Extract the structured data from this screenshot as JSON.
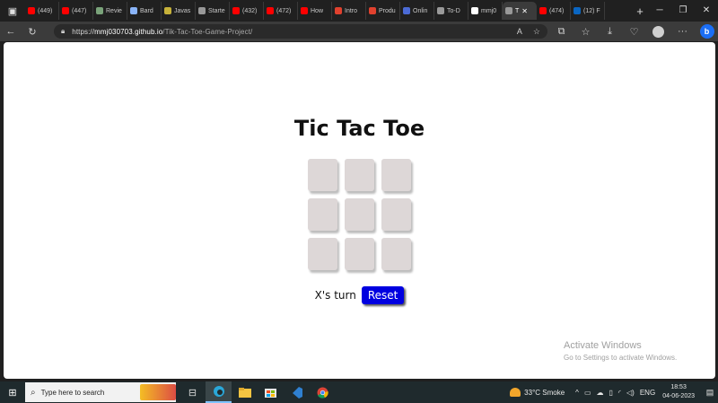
{
  "tabs": [
    {
      "label": "(449)",
      "icon": "youtube-icon",
      "color": "#ff0000"
    },
    {
      "label": "(447)",
      "icon": "youtube-icon",
      "color": "#ff0000"
    },
    {
      "label": "Revie",
      "icon": "review-icon",
      "color": "#7aa37a"
    },
    {
      "label": "Bard",
      "icon": "bard-icon",
      "color": "#8ab4f8"
    },
    {
      "label": "Javas",
      "icon": "js-icon",
      "color": "#c7b23a"
    },
    {
      "label": "Starte",
      "icon": "page-icon",
      "color": "#999999"
    },
    {
      "label": "(432)",
      "icon": "youtube-icon",
      "color": "#ff0000"
    },
    {
      "label": "(472)",
      "icon": "youtube-icon",
      "color": "#ff0000"
    },
    {
      "label": "How",
      "icon": "youtube-icon",
      "color": "#ff0000"
    },
    {
      "label": "Intro",
      "icon": "kp-icon",
      "color": "#e0412e"
    },
    {
      "label": "Produ",
      "icon": "kp-icon",
      "color": "#e0412e"
    },
    {
      "label": "Onlin",
      "icon": "online-icon",
      "color": "#4b6bd6"
    },
    {
      "label": "To-D",
      "icon": "page-icon",
      "color": "#999999"
    },
    {
      "label": "mmj0",
      "icon": "github-icon",
      "color": "#ffffff"
    },
    {
      "label": "T",
      "icon": "page-icon",
      "color": "#999999",
      "active": true
    },
    {
      "label": "(474)",
      "icon": "youtube-icon",
      "color": "#ff0000"
    },
    {
      "label": "(12) F",
      "icon": "linkedin-icon",
      "color": "#0a66c2"
    }
  ],
  "address": {
    "scheme": "https://",
    "host": "mmj030703.github.io",
    "path": "/Tik-Tac-Toe-Game-Project/"
  },
  "page": {
    "title": "Tic Tac Toe",
    "board": [
      "",
      "",
      "",
      "",
      "",
      "",
      "",
      "",
      ""
    ],
    "turn_text": "X's turn",
    "reset_label": "Reset"
  },
  "watermark": {
    "line1": "Activate Windows",
    "line2": "Go to Settings to activate Windows."
  },
  "taskbar": {
    "search_placeholder": "Type here to search",
    "weather": "33°C Smoke",
    "language": "ENG",
    "time": "18:53",
    "date": "04-06-2023"
  },
  "colors": {
    "reset_button": "#0000e0",
    "cell": "#ddd7d7",
    "accent": "#1b6ef5"
  }
}
